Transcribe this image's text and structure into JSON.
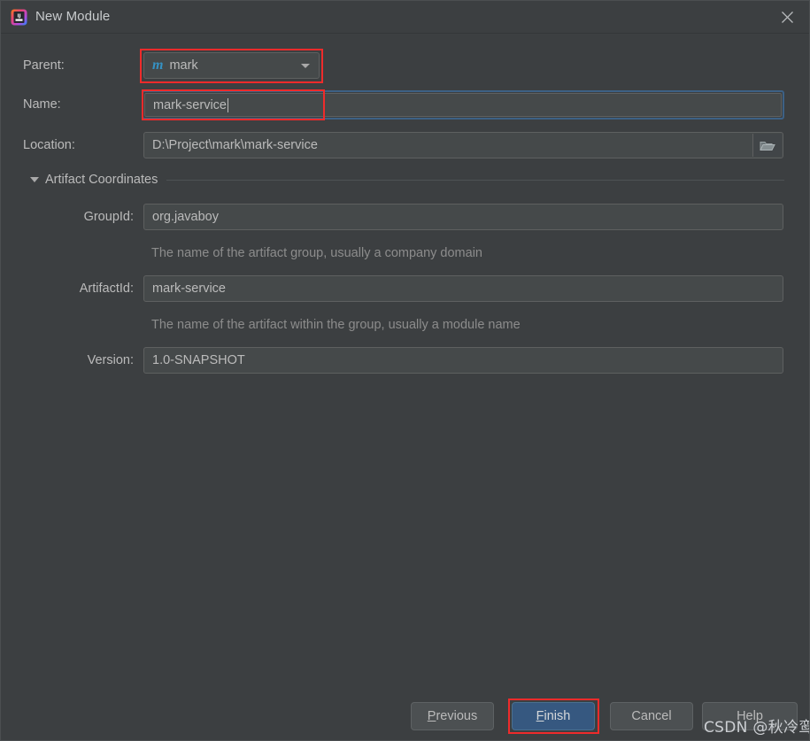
{
  "window": {
    "title": "New Module",
    "app_icon": "intellij-idea-icon",
    "close_icon": "close-icon",
    "background": "#3c3f41"
  },
  "form": {
    "parent": {
      "label": "Parent:",
      "value": "mark",
      "icon": "maven-module-icon",
      "icon_glyph": "m",
      "icon_color": "#3592c4",
      "dropdown_icon": "chevron-down-icon"
    },
    "name": {
      "label": "Name:",
      "value": "mark-service",
      "focused": true,
      "focus_color": "#3d6185"
    },
    "location": {
      "label": "Location:",
      "value": "D:\\Project\\mark\\mark-service",
      "browse_icon": "folder-icon"
    }
  },
  "artifact_coordinates": {
    "section_label": "Artifact Coordinates",
    "expander_icon": "triangle-down-icon",
    "group_id": {
      "label": "GroupId:",
      "value": "org.javaboy",
      "hint": "The name of the artifact group, usually a company domain"
    },
    "artifact_id": {
      "label": "ArtifactId:",
      "value": "mark-service",
      "hint": "The name of the artifact within the group, usually a module name"
    },
    "version": {
      "label": "Version:",
      "value": "1.0-SNAPSHOT"
    }
  },
  "buttons": {
    "previous": {
      "mnemonic": "P",
      "rest": "revious"
    },
    "finish": {
      "mnemonic": "F",
      "rest": "inish",
      "primary": true,
      "color": "#365880"
    },
    "cancel": {
      "label": "Cancel"
    },
    "help": {
      "label": "Help"
    }
  },
  "annotations": {
    "color": "#ee2b2b",
    "boxes": [
      "parent-combo",
      "name-field",
      "finish-button"
    ]
  },
  "watermark": {
    "text": "CSDN @秋冷鸾"
  }
}
